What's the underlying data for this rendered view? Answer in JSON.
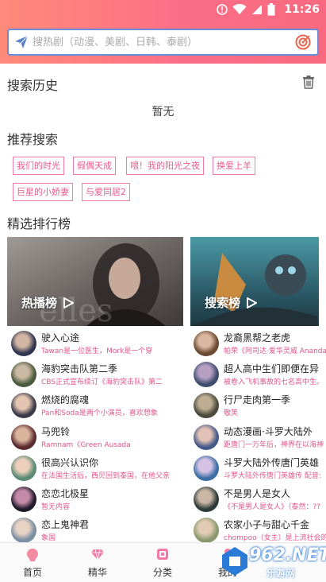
{
  "status": {
    "time": "11:26"
  },
  "search": {
    "placeholder": "搜热剧（动漫、美剧、日韩、泰剧）"
  },
  "history": {
    "title": "搜索历史",
    "empty_text": "暂无"
  },
  "recommend": {
    "title": "推荐搜索",
    "tags": [
      "我们的时光",
      "假偶天成",
      "喂！我的阳光之夜",
      "换爱上羊",
      "巨星的小娇妻",
      "与爱同居2"
    ]
  },
  "ranking": {
    "title": "精选排行榜",
    "banners": [
      {
        "label": "热播榜",
        "color": "#8a8a8a"
      },
      {
        "label": "搜索榜",
        "color": "#3f7f8f"
      }
    ],
    "left": [
      {
        "title": "驶入心途",
        "desc": "Tawan是一位医生，Mork是一个穿"
      },
      {
        "title": "海豹突击队第二季",
        "desc": "CBS正式宣布续订《海豹突击队》第二"
      },
      {
        "title": "燃烧的腐魂",
        "desc": "Pan和Soda是两个小演员，喜欢想象"
      },
      {
        "title": "马兜铃",
        "desc": "Ramnam《Green Ausada"
      },
      {
        "title": "很高兴认识你",
        "desc": "在法国生活后，西贝回到泰国，在他父亲的"
      },
      {
        "title": "恋恋北极星",
        "desc": "暂无内容"
      },
      {
        "title": "恋上鬼神君",
        "desc": "象国"
      }
    ],
    "right": [
      {
        "title": "龙裔黑帮之老虎",
        "desc": "帕荣《阿司达·爱华灵威 Ananda"
      },
      {
        "title": "超人高中生们即便在异",
        "desc": "被卷入飞机事故的七名高中生。"
      },
      {
        "title": "行尸走肉第一季",
        "desc": "敬笑"
      },
      {
        "title": "动态漫画·斗罗大陆外",
        "desc": "距唐门一万年后，神界在以海神"
      },
      {
        "title": "斗罗大陆外传唐门英雄",
        "desc": "斗罗大陆外传唐门英雄传 配音:"
      },
      {
        "title": "不是男人是女人",
        "desc": "《不是男人是女人》（泰然：??"
      },
      {
        "title": "农家小子与甜心千金",
        "desc": "chompoo（女主）是上流社会的"
      }
    ]
  },
  "tabs": [
    {
      "label": "首页"
    },
    {
      "label": "精华"
    },
    {
      "label": "分类"
    },
    {
      "label": "我的"
    }
  ],
  "watermark": {
    "text": "962.NET",
    "sub": "乐游网"
  },
  "colors": {
    "accent": "#f8697f",
    "tag": "#ec5a8d",
    "searchBorder": "#6b8cd6"
  }
}
